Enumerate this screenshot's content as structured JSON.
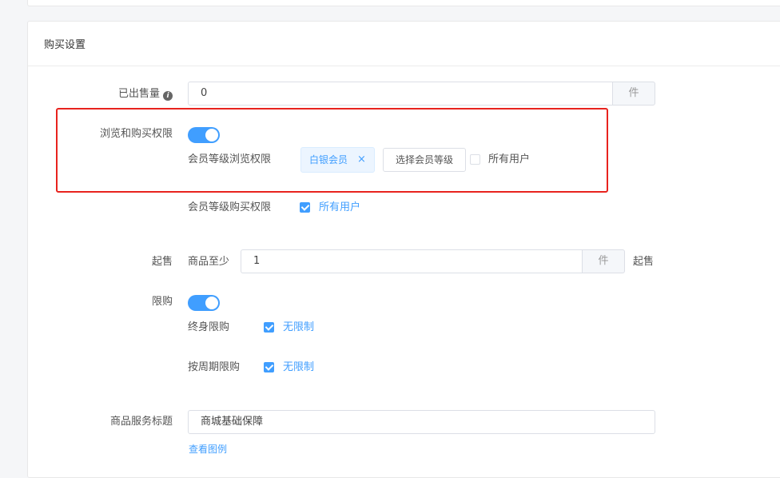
{
  "section_title": "购买设置",
  "sold": {
    "label": "已出售量",
    "icon": "info-icon",
    "value": "0",
    "unit": "件"
  },
  "browse_purchase": {
    "label": "浏览和购买权限",
    "toggle_on": true,
    "browse_label": "会员等级浏览权限",
    "browse_tag": "白银会员",
    "browse_tag_close": "×",
    "select_level_button": "选择会员等级",
    "browse_all_users": "所有用户",
    "browse_all_checked": false,
    "purchase_label": "会员等级购买权限",
    "purchase_all_users": "所有用户",
    "purchase_all_checked": true
  },
  "min_purchase": {
    "label": "起售",
    "prefix": "商品至少",
    "value": "1",
    "unit": "件",
    "suffix": "起售"
  },
  "limit": {
    "label": "限购",
    "toggle_on": true,
    "lifetime_label": "终身限购",
    "lifetime_option": "无限制",
    "lifetime_checked": true,
    "period_label": "按周期限购",
    "period_option": "无限制",
    "period_checked": true
  },
  "service_title": {
    "label": "商品服务标题",
    "value": "商城基础保障",
    "example_link": "查看图例"
  },
  "colors": {
    "accent": "#409eff",
    "highlight": "#e8231e"
  }
}
